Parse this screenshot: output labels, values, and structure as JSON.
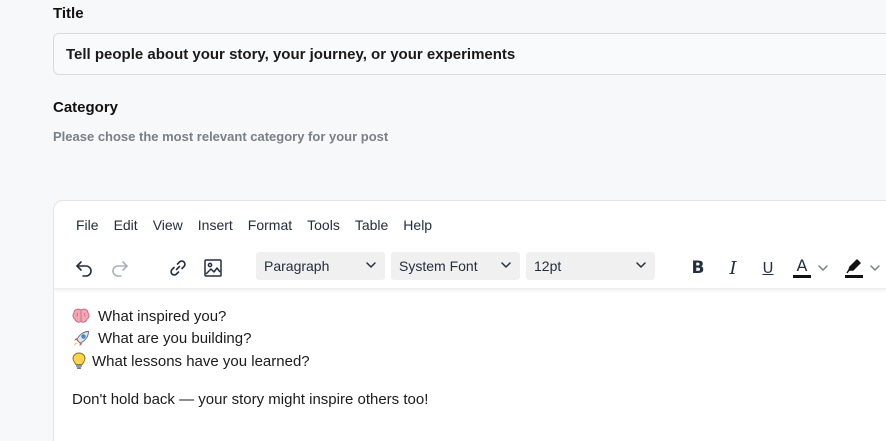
{
  "form": {
    "title_label": "Title",
    "title_value": "Tell people about your story, your journey, or your experiments",
    "category_label": "Category",
    "category_help": "Please chose the most relevant category for your post"
  },
  "editor": {
    "menu": [
      "File",
      "Edit",
      "View",
      "Insert",
      "Format",
      "Tools",
      "Table",
      "Help"
    ],
    "toolbar": {
      "block_format": "Paragraph",
      "font_family": "System Font",
      "font_size": "12pt",
      "bold": "B",
      "italic": "I",
      "underline": "U",
      "text_color": "A"
    },
    "content": {
      "prompts": [
        {
          "icon": "brain-icon",
          "text": "What inspired you?"
        },
        {
          "icon": "rocket-icon",
          "text": "What are you building?"
        },
        {
          "icon": "lightbulb-icon",
          "text": "What lessons have you learned?"
        }
      ],
      "closing": "Don't hold back — your story might inspire others too!"
    }
  },
  "colors": {
    "page_bg": "#f7f8f9",
    "toolbar_icon": "#222f3e",
    "disabled_icon": "#a8b0ba"
  }
}
